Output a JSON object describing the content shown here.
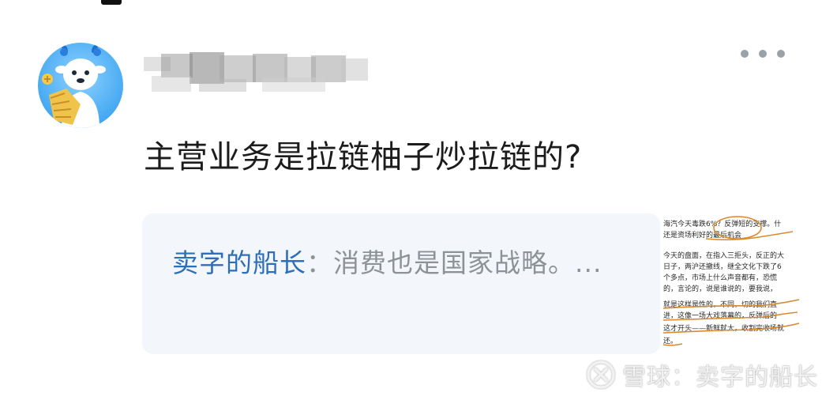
{
  "post": {
    "username": "",
    "text": "主营业务是拉链柚子炒拉链的?"
  },
  "quote": {
    "author": "卖字的船长",
    "separator": "：",
    "body": "消费也是国家战略。..."
  },
  "thumbnail_text": [
    "海汽今天毒跌6%？反弹短的支撑。什",
    "还是资场利好的最后机会",
    "今天的盘面，在指入三拒头，反正的大",
    "日子，两沪还撤线，继全文化下跌了6",
    "个多点，市场上什么声音都有，恐慌",
    "的，言论的，说是谁说的，要我说，",
    "就是这样是性的，不同，切的我们直",
    "进，这像一场大戏落幕的，反弹后的",
    "这才开头——新鲜就大，收割完收场就",
    "还。"
  ],
  "watermark": {
    "platform": "雪球",
    "sep": "：",
    "author": "卖字的船长"
  },
  "icons": {
    "more": "more-horizontal-icon",
    "watermark": "snowball-logo-icon"
  },
  "colors": {
    "quote_author": "#2f6fb8",
    "quote_body": "#8d9297",
    "card_bg": "#f3f6fa",
    "annotation": "#d98a2b"
  }
}
